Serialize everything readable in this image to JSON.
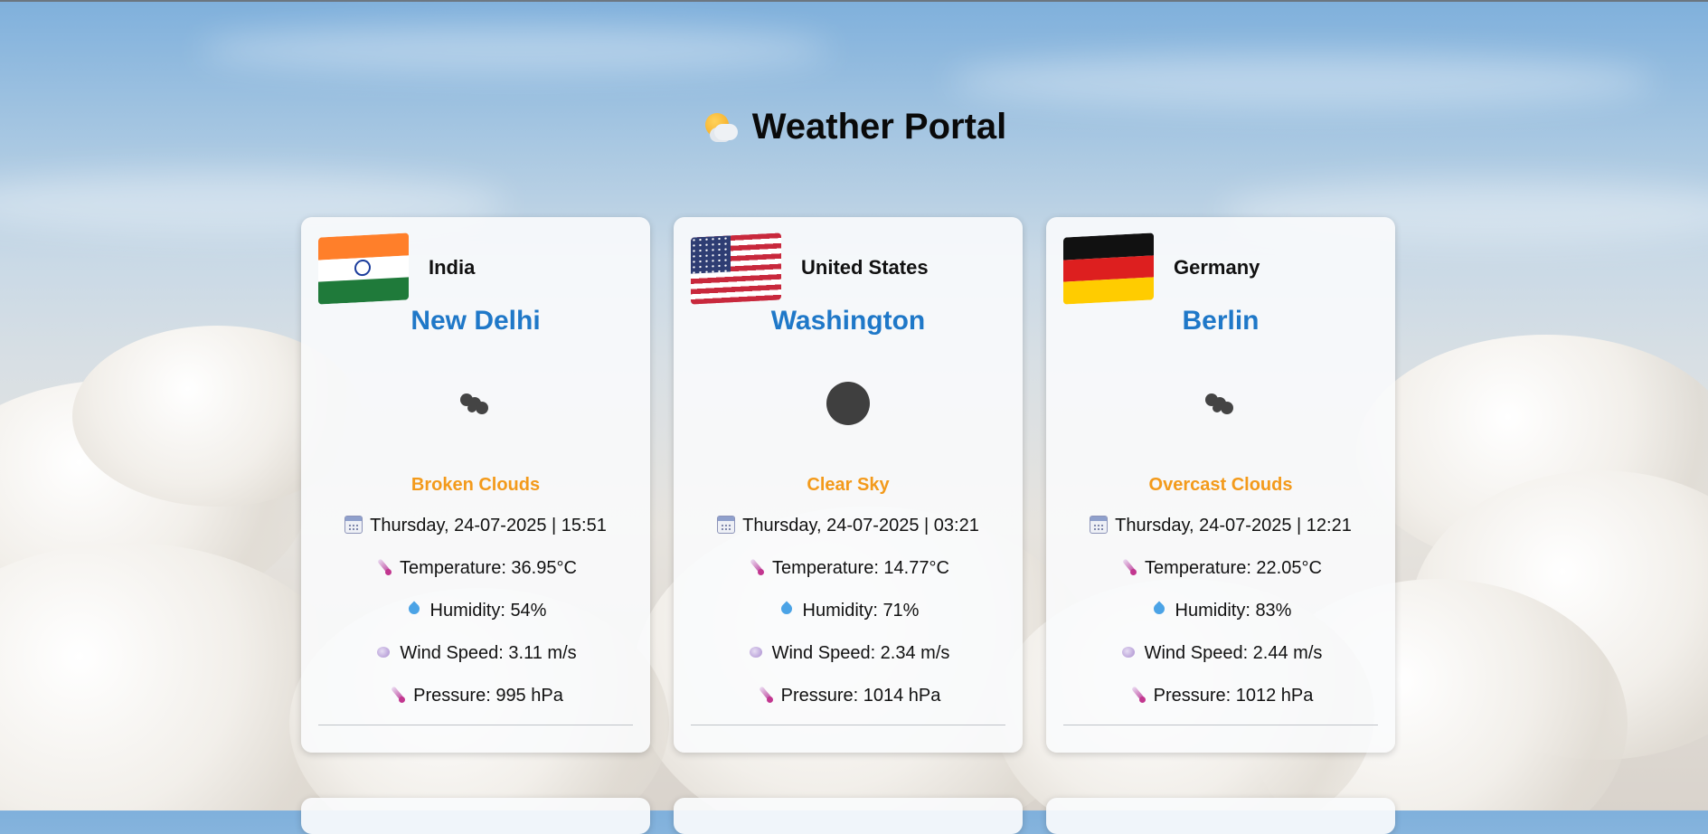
{
  "page": {
    "title": "Weather Portal",
    "title_icon": "sun-behind-cloud-icon"
  },
  "cards": [
    {
      "country": "India",
      "flag": "india-flag-icon",
      "city": "New Delhi",
      "weather_icon": "cloud-icon",
      "description": "Broken Clouds",
      "datetime": "Thursday, 24-07-2025 | 15:51",
      "temperature": "Temperature: 36.95°C",
      "humidity": "Humidity: 54%",
      "wind": "Wind Speed: 3.11 m/s",
      "pressure": "Pressure: 995 hPa"
    },
    {
      "country": "United States",
      "flag": "united-states-flag-icon",
      "city": "Washington",
      "weather_icon": "clear-sky-icon",
      "description": "Clear Sky",
      "datetime": "Thursday, 24-07-2025 | 03:21",
      "temperature": "Temperature: 14.77°C",
      "humidity": "Humidity: 71%",
      "wind": "Wind Speed: 2.34 m/s",
      "pressure": "Pressure: 1014 hPa"
    },
    {
      "country": "Germany",
      "flag": "germany-flag-icon",
      "city": "Berlin",
      "weather_icon": "cloud-icon",
      "description": "Overcast Clouds",
      "datetime": "Thursday, 24-07-2025 | 12:21",
      "temperature": "Temperature: 22.05°C",
      "humidity": "Humidity: 83%",
      "wind": "Wind Speed: 2.44 m/s",
      "pressure": "Pressure: 1012 hPa"
    }
  ],
  "colors": {
    "city": "#1f78c8",
    "description": "#f39a1b",
    "card_background": "#fafbfc"
  }
}
